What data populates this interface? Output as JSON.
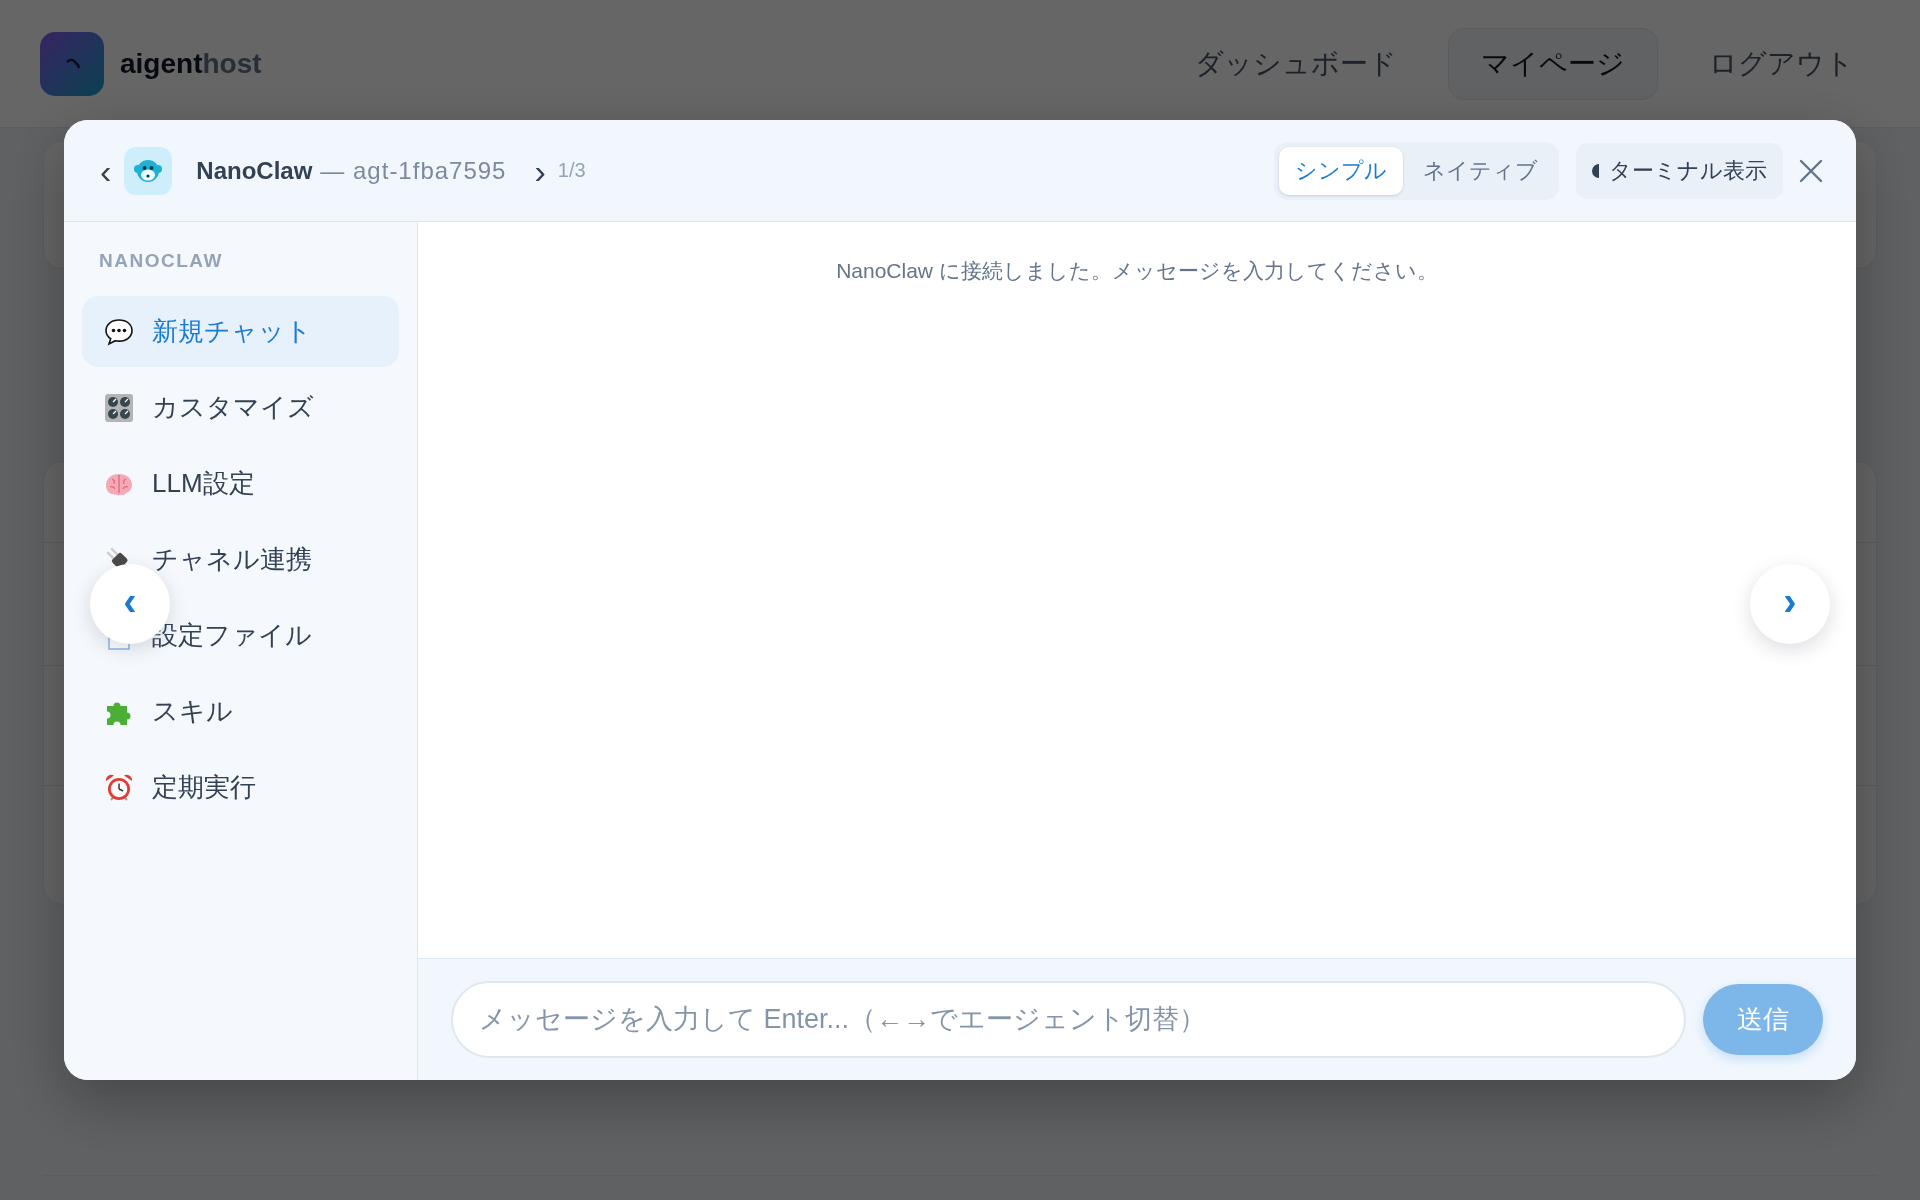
{
  "background_page": {
    "brand": {
      "primary": "aigent",
      "secondary": "host"
    },
    "nav": [
      {
        "label": "ダッシュボード",
        "selected": false
      },
      {
        "label": "マイページ",
        "selected": true
      },
      {
        "label": "ログアウト",
        "selected": false
      }
    ]
  },
  "dialog": {
    "header": {
      "prev": "‹",
      "title": "NanoClaw",
      "agent_id": "— agt-1fba7595",
      "next": "›",
      "counter": "1/3",
      "view_modes": [
        {
          "label": "シンプル",
          "selected": true
        },
        {
          "label": "ネイティブ",
          "selected": false
        }
      ],
      "terminal_button": "ターミナル表示"
    },
    "sidebar": {
      "section": "NANOCLAW",
      "items": [
        {
          "label": "新規チャット",
          "kind": "chat",
          "selected": true
        },
        {
          "label": "カスタマイズ",
          "kind": "knobs",
          "selected": false
        },
        {
          "label": "LLM設定",
          "kind": "brain",
          "selected": false
        },
        {
          "label": "チャネル連携",
          "kind": "plug",
          "selected": false
        },
        {
          "label": "設定ファイル",
          "kind": "document",
          "selected": false
        },
        {
          "label": "スキル",
          "kind": "puzzle",
          "selected": false
        },
        {
          "label": "定期実行",
          "kind": "alarm",
          "selected": false
        }
      ]
    },
    "chat": {
      "system_message": "NanoClaw に接続しました。メッセージを入力してください。"
    },
    "composer": {
      "placeholder": "メッセージを入力して Enter...（←→でエージェント切替）",
      "send": {
        "label": "送信",
        "disabled": true
      }
    }
  },
  "carousel": {
    "prev": "‹",
    "next": "›"
  }
}
